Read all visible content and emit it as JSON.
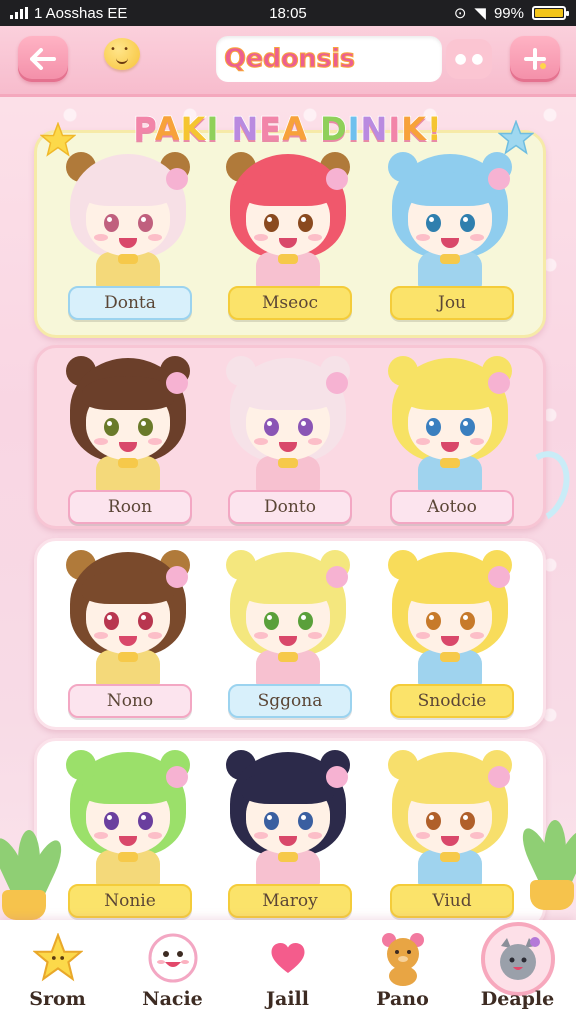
{
  "status_bar": {
    "carrier": "1 Aosshas EE",
    "time": "18:05",
    "battery": "99%",
    "battery_level": 0.99
  },
  "header": {
    "back_icon": "arrow-left-icon",
    "mascot_icon": "smiley-chick-icon",
    "search_text": "Qedonsis",
    "filter_icon": "filter-icon",
    "edit_icon": "edit-sparkle-icon"
  },
  "banner": {
    "title": "PAKI NEA DINIK!"
  },
  "panels": [
    {
      "id": "panel-1",
      "characters": [
        {
          "label": "Donta",
          "label_style": "blue",
          "hair": "#f7e0e6",
          "eye": "#c0607e"
        },
        {
          "label": "Mseoc",
          "label_style": "yellow",
          "hair": "#f0586c",
          "eye": "#8a4a1f"
        },
        {
          "label": "Jou",
          "label_style": "yellow",
          "hair": "#8fcdee",
          "eye": "#2f7fae"
        }
      ]
    },
    {
      "id": "panel-2",
      "characters": [
        {
          "label": "Roon",
          "label_style": "pink",
          "hair": "#6b3f2a",
          "eye": "#6a7a2a"
        },
        {
          "label": "Donto",
          "label_style": "pink",
          "hair": "#f6e2e8",
          "eye": "#8a55b5"
        },
        {
          "label": "Aotoo",
          "label_style": "pink",
          "hair": "#f7e264",
          "eye": "#3a7fbf"
        }
      ]
    },
    {
      "id": "panel-3",
      "characters": [
        {
          "label": "Nono",
          "label_style": "pink",
          "hair": "#7a4a2c",
          "eye": "#b8364f"
        },
        {
          "label": "Sggona",
          "label_style": "blue",
          "hair": "#f4e77e",
          "eye": "#5aa03a"
        },
        {
          "label": "Snodcie",
          "label_style": "yellow",
          "hair": "#f8dc5a",
          "eye": "#c77a2a"
        }
      ]
    },
    {
      "id": "panel-4",
      "characters": [
        {
          "label": "Nonie",
          "label_style": "yellow",
          "hair": "#9be06a",
          "eye": "#6a3f9e"
        },
        {
          "label": "Maroy",
          "label_style": "yellow",
          "hair": "#2c2a4a",
          "eye": "#3a5fa0"
        },
        {
          "label": "Viud",
          "label_style": "yellow",
          "hair": "#f7df6c",
          "eye": "#b0602a"
        }
      ]
    }
  ],
  "nav": [
    {
      "label": "Srom",
      "icon": "star-icon",
      "active": false
    },
    {
      "label": "Nacie",
      "icon": "smile-face-icon",
      "active": false
    },
    {
      "label": "Jaill",
      "icon": "heart-icon",
      "active": false
    },
    {
      "label": "Pano",
      "icon": "bear-icon",
      "active": false
    },
    {
      "label": "Deaple",
      "icon": "cat-icon",
      "active": true
    }
  ],
  "colors": {
    "accent": "#f38ea8",
    "header_bg": "#f7bccd",
    "banner_pink": "#f285a9"
  }
}
